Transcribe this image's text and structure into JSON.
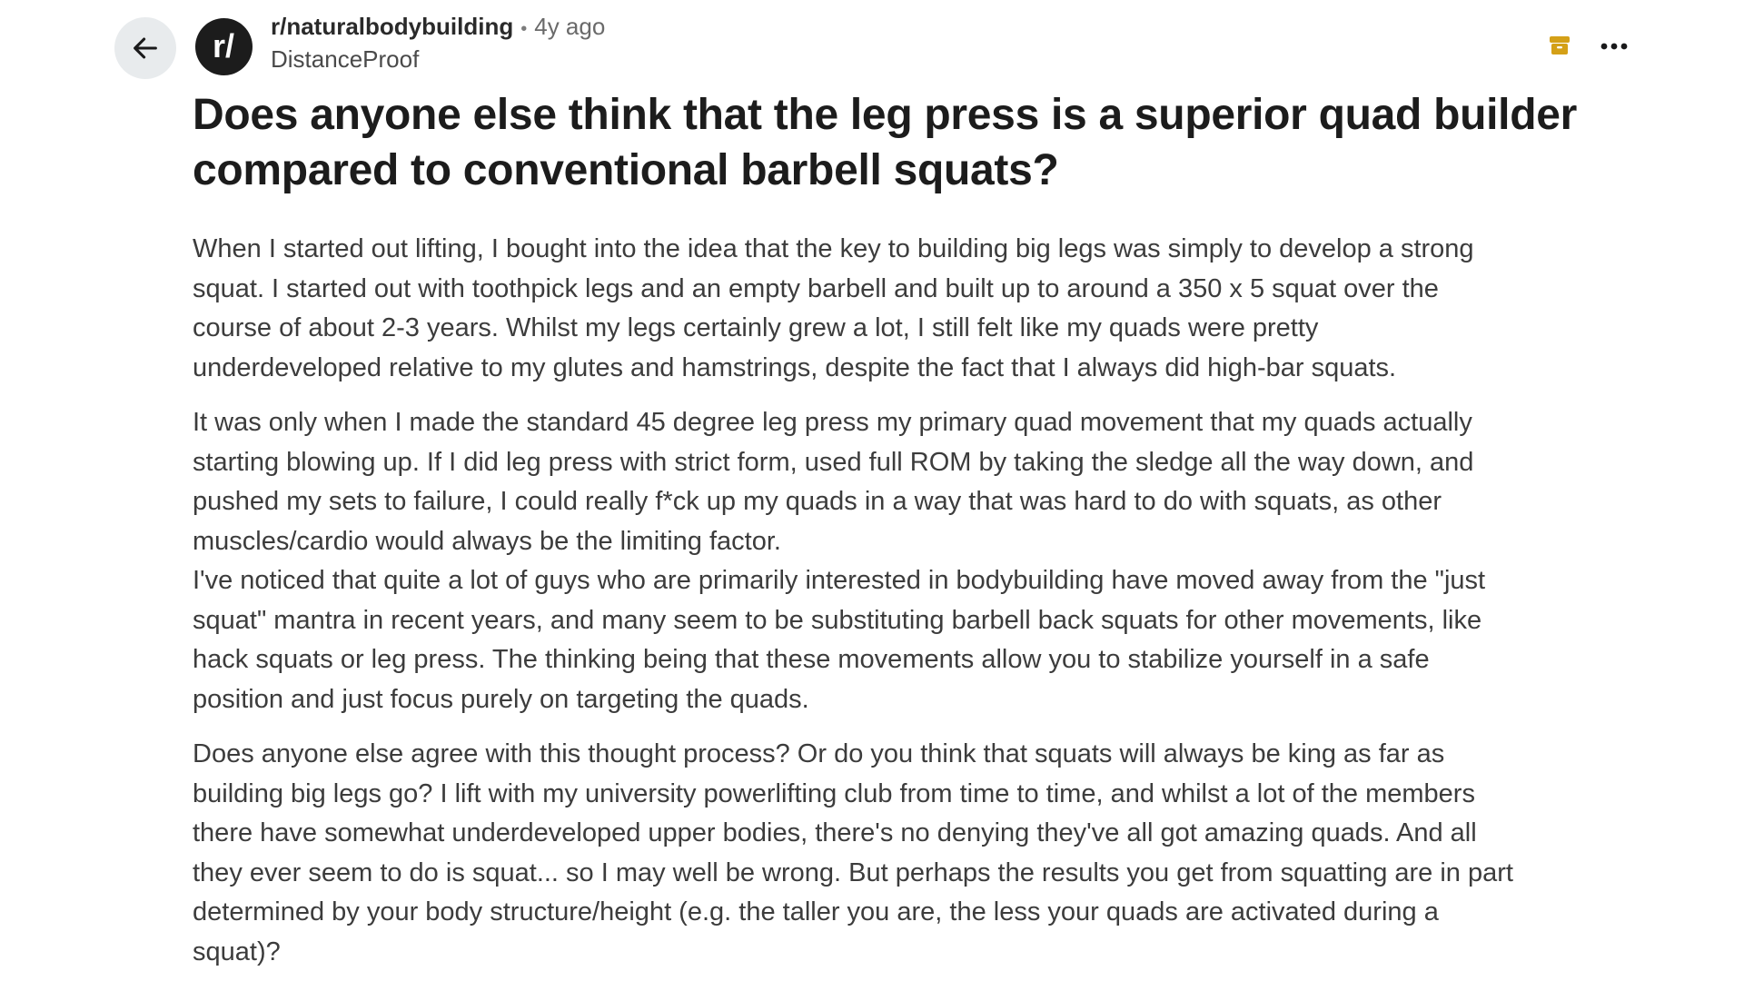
{
  "header": {
    "subreddit": "r/naturalbodybuilding",
    "separator": "•",
    "age": "4y ago",
    "author": "DistanceProof",
    "avatar_text": "r/"
  },
  "icons": {
    "back": "arrow-left-icon",
    "archive": "archive-icon",
    "more": "more-horizontal-icon"
  },
  "colors": {
    "archive_accent": "#d4a017",
    "back_bg": "#e8ebed",
    "avatar_bg": "#1c1c1c"
  },
  "post": {
    "title_lines": [
      "Does anyone else think that the leg press is a superior quad",
      "builder compared to conventional barbell squats?"
    ],
    "paragraphs": [
      {
        "lines": [
          "When I started out lifting, I bought into the idea that the key to building big legs was simply to develop a strong",
          "squat. I started out with toothpick legs and an empty barbell and built up to around a 350 x 5 squat over the",
          "course of about 2-3 years. Whilst my legs certainly grew a lot, I still felt like my quads were pretty",
          "underdeveloped relative to my glutes and hamstrings, despite the fact that I always did high-bar squats."
        ]
      },
      {
        "lines": [
          "It was only when I made the standard 45 degree leg press my primary quad movement that my quads actually",
          "starting blowing up. If I did leg press with strict form, used full ROM by taking the sledge all the way down, and",
          "pushed my sets to failure, I could really f*ck up my quads in a way that was hard to do with squats, as other",
          "muscles/cardio would always be the limiting factor.",
          "I've noticed that quite a lot of guys who are primarily interested in bodybuilding have moved away from the \"just",
          "squat\" mantra in recent years, and many seem to be substituting barbell back squats for other movements, like",
          "hack squats or leg press. The thinking being that these movements allow you to stabilize yourself in a safe",
          "position and just focus purely on targeting the quads."
        ]
      },
      {
        "lines": [
          "Does anyone else agree with this thought process? Or do you think that squats will always be king as far as",
          "building big legs go? I lift with my university powerlifting club from time to time, and whilst a lot of the members",
          "there have somewhat underdeveloped upper bodies, there's no denying they've all got amazing quads. And all",
          "they ever seem to do is squat... so I may well be wrong. But perhaps the results you get from squatting are in part",
          "determined by your body structure/height (e.g. the taller you are, the less your quads are activated during a",
          "squat)?"
        ]
      }
    ]
  }
}
